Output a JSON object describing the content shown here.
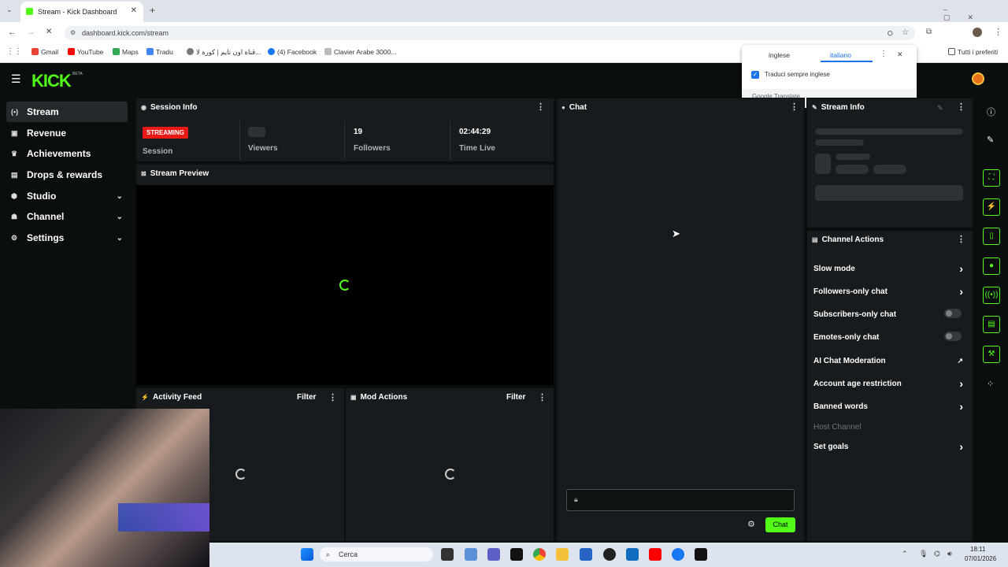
{
  "browser": {
    "tab_title": "Stream - Kick Dashboard",
    "url": "dashboard.kick.com/stream",
    "bookmarks": [
      "Gmail",
      "YouTube",
      "Maps",
      "Tradu",
      "قناة اون تايم | كورة لا...",
      "(4) Facebook",
      "Clavier Arabe 3000...",
      "Tutti i preferiti"
    ]
  },
  "translate_popup": {
    "lang_from": "inglese",
    "lang_to": "italiano",
    "always_label": "Traduci sempre inglese",
    "brand": "Google Translate"
  },
  "app": {
    "logo": "KICK",
    "beta": "BETA"
  },
  "sidebar": {
    "items": [
      {
        "label": "Stream",
        "icon": "broadcast-icon"
      },
      {
        "label": "Revenue",
        "icon": "wallet-icon"
      },
      {
        "label": "Achievements",
        "icon": "trophy-icon"
      },
      {
        "label": "Drops & rewards",
        "icon": "gift-icon"
      },
      {
        "label": "Studio",
        "icon": "studio-icon"
      },
      {
        "label": "Channel",
        "icon": "channel-icon"
      },
      {
        "label": "Settings",
        "icon": "gear-icon"
      }
    ]
  },
  "session_info": {
    "title": "Session Info",
    "badge": "STREAMING",
    "session_label": "Session",
    "viewers_label": "Viewers",
    "followers_value": "19",
    "followers_label": "Followers",
    "time_value": "02:44:29",
    "time_label": "Time Live"
  },
  "stream_preview": {
    "title": "Stream Preview"
  },
  "activity_feed": {
    "title": "Activity Feed",
    "filter": "Filter"
  },
  "mod_actions": {
    "title": "Mod Actions",
    "filter": "Filter"
  },
  "chat": {
    "title": "Chat",
    "send": "Chat"
  },
  "stream_info": {
    "title": "Stream Info"
  },
  "channel_actions": {
    "title": "Channel Actions",
    "items": [
      {
        "label": "Slow mode",
        "control": "arrow"
      },
      {
        "label": "Followers-only chat",
        "control": "arrow"
      },
      {
        "label": "Subscribers-only chat",
        "control": "toggle"
      },
      {
        "label": "Emotes-only chat",
        "control": "toggle"
      },
      {
        "label": "AI Chat Moderation",
        "control": "external"
      },
      {
        "label": "Account age restriction",
        "control": "arrow"
      },
      {
        "label": "Banned words",
        "control": "arrow"
      },
      {
        "label": "Host Channel",
        "control": "none"
      },
      {
        "label": "Set goals",
        "control": "arrow"
      }
    ]
  },
  "taskbar": {
    "search": "Cerca",
    "time": "18:11",
    "date": "07/01/2026"
  },
  "colors": {
    "accent": "#53fc18",
    "badge": "#e91916"
  }
}
